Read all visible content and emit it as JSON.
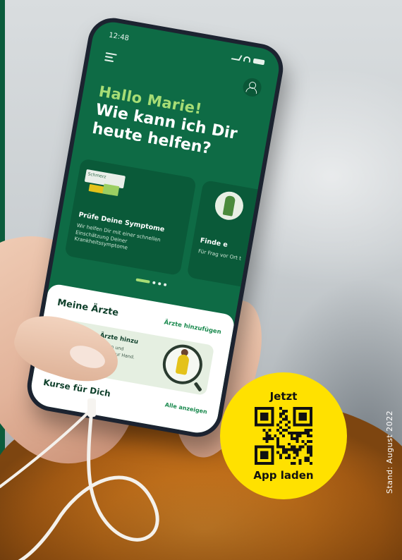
{
  "colors": {
    "brand_green": "#0e6b45",
    "accent_lime": "#a7dd75",
    "badge_yellow": "#ffe100",
    "stripe_green": "#0b5c3c"
  },
  "phone": {
    "status_bar": {
      "time": "12:48"
    },
    "icons": {
      "menu": "menu-icon",
      "profile": "profile-icon"
    },
    "greeting": "Hallo Marie!",
    "question": "Wie kann ich Dir heute helfen?",
    "cards": [
      {
        "illustration_label": "Schmerz",
        "title": "Prüfe Deine Symptome",
        "text": "Wir helfen Dir mit einer schnellen Einschätzung Deiner Krankheitssymptome"
      },
      {
        "title": "Finde e",
        "text": "Für Frag vor Ort t"
      }
    ],
    "pager": {
      "count": 4,
      "active": 1
    },
    "sheet": {
      "title": "Meine Ärzte",
      "link": "Ärzte hinzufügen",
      "doc_card": {
        "title": "Füge Deine Ärzte hinzu",
        "text": "So hast Du Kontaktdaten und Öffnungszeiten jederzeit zur Hand."
      },
      "footer_title": "Kurse für Dich",
      "footer_link": "Alle anzeigen"
    }
  },
  "badge": {
    "top": "Jetzt",
    "bottom": "App laden",
    "qr_icon": "qr-code-icon"
  },
  "date_note": "Stand: August 2022"
}
